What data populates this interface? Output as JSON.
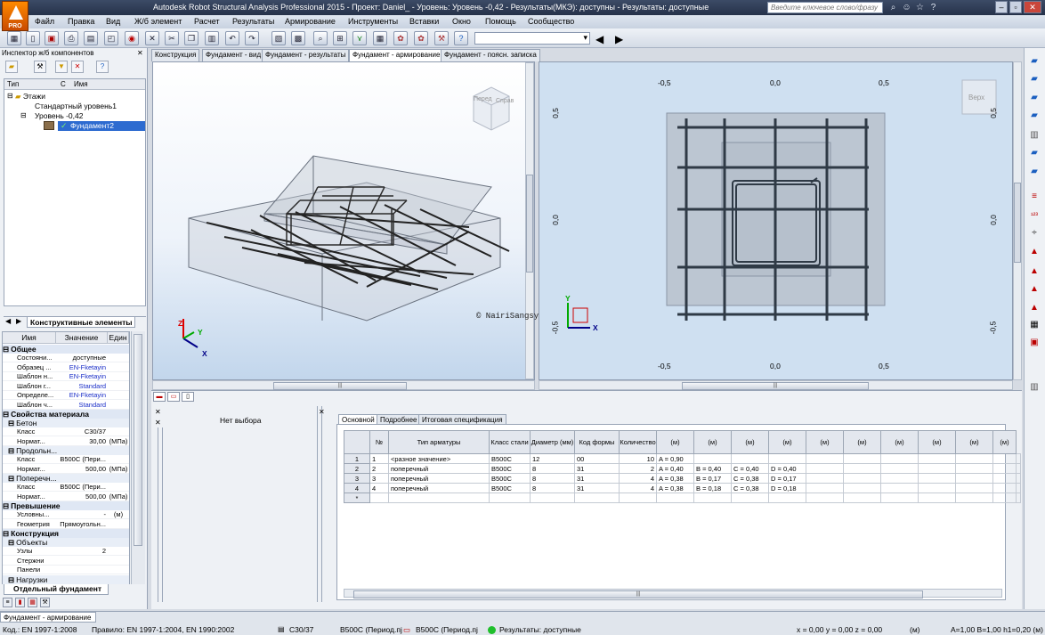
{
  "window": {
    "title": "Autodesk Robot Structural Analysis Professional 2015 - Проект: Daniel_ - Уровень: Уровень -0,42 - Результаты(МКЭ): доступны - Результаты: доступные",
    "logo_text": "PRO",
    "search_placeholder": "Введите ключевое слово/фразу"
  },
  "menu": [
    "Файл",
    "Правка",
    "Вид",
    "Ж/б элемент",
    "Расчет",
    "Результаты",
    "Армирование",
    "Инструменты",
    "Вставки",
    "Окно",
    "Помощь",
    "Сообщество"
  ],
  "inspector": {
    "title": "Инспектор ж/б компонентов",
    "tree_headers": [
      "Тип",
      "С",
      "Имя"
    ],
    "tree": [
      {
        "label": "Этажи",
        "level": 0
      },
      {
        "label": "Стандартный уровень1",
        "level": 1
      },
      {
        "label": "Уровень -0,42",
        "level": 1
      },
      {
        "label": "Фундамент2",
        "level": 2,
        "selected": true
      }
    ],
    "tab_label": "Конструктивные элементы"
  },
  "properties": {
    "headers": [
      "Имя",
      "Значение",
      "Един"
    ],
    "groups": [
      {
        "name": "Общее",
        "rows": [
          {
            "name": "Состояни...",
            "value": "доступные",
            "unit": "",
            "blue": false
          },
          {
            "name": "Образец ...",
            "value": "EN-Fketayin",
            "unit": "",
            "blue": true
          },
          {
            "name": "Шаблон н...",
            "value": "EN-Fketayin",
            "unit": "",
            "blue": true
          },
          {
            "name": "Шаблон г...",
            "value": "Standard",
            "unit": "",
            "blue": true
          },
          {
            "name": "Определе...",
            "value": "EN-Fketayin",
            "unit": "",
            "blue": true
          },
          {
            "name": "Шаблон ч...",
            "value": "Standard",
            "unit": "",
            "blue": true
          }
        ]
      },
      {
        "name": "Свойства материала",
        "rows": []
      },
      {
        "name": "Бетон",
        "sub": true,
        "rows": [
          {
            "name": "Класс",
            "value": "C30/37",
            "unit": ""
          },
          {
            "name": "Нормат...",
            "value": "30,00",
            "unit": "(МПа)"
          }
        ]
      },
      {
        "name": "Продольн...",
        "sub": true,
        "rows": [
          {
            "name": "Класс",
            "value": "B500C (Пери...",
            "unit": ""
          },
          {
            "name": "Нормат...",
            "value": "500,00",
            "unit": "(МПа)"
          }
        ]
      },
      {
        "name": "Поперечн...",
        "sub": true,
        "rows": [
          {
            "name": "Класс",
            "value": "B500C (Пери...",
            "unit": ""
          },
          {
            "name": "Нормат...",
            "value": "500,00",
            "unit": "(МПа)"
          }
        ]
      },
      {
        "name": "Превышение",
        "rows": [
          {
            "name": "Условны...",
            "value": "-",
            "unit": "(м)"
          },
          {
            "name": "Геометрия",
            "value": "Прямоугольн...",
            "unit": ""
          }
        ]
      },
      {
        "name": "Конструкция",
        "rows": []
      },
      {
        "name": "Объекты",
        "sub": true,
        "rows": [
          {
            "name": "Узлы",
            "value": "2",
            "unit": ""
          },
          {
            "name": "Стержни",
            "value": "",
            "unit": ""
          },
          {
            "name": "Панели",
            "value": "",
            "unit": ""
          }
        ]
      },
      {
        "name": "Нагрузки",
        "sub": true,
        "rows": []
      }
    ],
    "tab_label": "Отдельный фундамент"
  },
  "view_tabs": [
    "Конструкция",
    "Фундамент - вид",
    "Фундамент - результаты",
    "Фундамент - армирование",
    "Фундамент - поясн. записка"
  ],
  "active_view_tab": 3,
  "view3d": {
    "cube_faces": [
      "Перед",
      "Справ"
    ],
    "watermark": "© NairiSangsyan.com",
    "axes": [
      "Z",
      "Y",
      "X"
    ]
  },
  "view2d": {
    "cube_face": "Верх",
    "top_ticks": [
      "-0,5",
      "0,0",
      "0,5"
    ],
    "bottom_ticks": [
      "-0,5",
      "0,0",
      "0,5"
    ],
    "left_ticks": [
      "0,5",
      "0,0",
      "-0,5"
    ],
    "right_ticks": [
      "0,5",
      "0,0",
      "-0,5"
    ],
    "axes": [
      "Y",
      "X"
    ]
  },
  "bottom": {
    "no_selection": "Нет выбора",
    "tabs": [
      "Основной",
      "Подробнее",
      "Итоговая спецификация"
    ],
    "columns": [
      "№",
      "Тип арматуры",
      "Класс стали",
      "Диаметр (мм)",
      "Код формы",
      "Количество",
      "(м)",
      "(м)",
      "(м)",
      "(м)",
      "(м)",
      "(м)",
      "(м)",
      "(м)",
      "(м)",
      "(м)"
    ],
    "rows": [
      {
        "row": "1",
        "n": "1",
        "type": "<разное значение>",
        "steel": "B500C",
        "dia": "12",
        "code": "00",
        "qty": "10",
        "a": "A = 0,90",
        "b": "",
        "c": "",
        "d": ""
      },
      {
        "row": "2",
        "n": "2",
        "type": "поперечный",
        "steel": "B500C",
        "dia": "8",
        "code": "31",
        "qty": "2",
        "a": "A = 0,40",
        "b": "B = 0,40",
        "c": "C = 0,40",
        "d": "D = 0,40"
      },
      {
        "row": "3",
        "n": "3",
        "type": "поперечный",
        "steel": "B500C",
        "dia": "8",
        "code": "31",
        "qty": "4",
        "a": "A = 0,38",
        "b": "B = 0,17",
        "c": "C = 0,38",
        "d": "D = 0,17"
      },
      {
        "row": "4",
        "n": "4",
        "type": "поперечный",
        "steel": "B500C",
        "dia": "8",
        "code": "31",
        "qty": "4",
        "a": "A = 0,38",
        "b": "B = 0,18",
        "c": "C = 0,38",
        "d": "D = 0,18"
      },
      {
        "row": "*",
        "n": "",
        "type": "",
        "steel": "",
        "dia": "",
        "code": "",
        "qty": "",
        "a": "",
        "b": "",
        "c": "",
        "d": ""
      }
    ]
  },
  "status": {
    "tab": "Фундамент - армирование",
    "code": "Код.: EN 1997-1:2008",
    "rule": "Правило: EN 1997-1:2004, EN 1990:2002",
    "concrete": "C30/37",
    "steel1": "B500C (Период.пј",
    "steel2": "B500C (Период.пј",
    "results": "Результаты: доступные",
    "coords": "x = 0,00 y = 0,00 z = 0,00",
    "unit": "(м)",
    "dims": "A=1,00 B=1,00 h1=0,20 (м)"
  }
}
